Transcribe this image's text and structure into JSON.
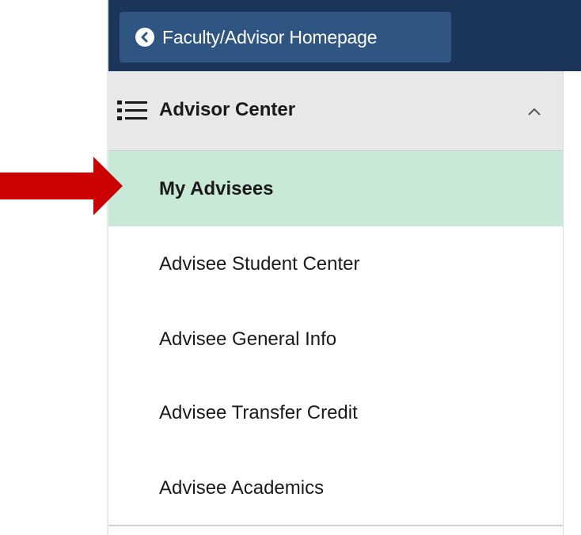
{
  "header": {
    "back_button_label": "Faculty/Advisor Homepage",
    "background_color": "#1c3659",
    "button_color": "#2f5582"
  },
  "nav": {
    "section_title": "Advisor Center",
    "section_icon": "list-icon",
    "collapse_icon": "chevron-up-icon",
    "items": [
      {
        "label": "My Advisees",
        "active": true
      },
      {
        "label": "Advisee Student Center",
        "active": false
      },
      {
        "label": "Advisee General Info",
        "active": false
      },
      {
        "label": "Advisee Transfer Credit",
        "active": false
      },
      {
        "label": "Advisee Academics",
        "active": false
      }
    ],
    "active_color": "#c9e9d8"
  },
  "annotation": {
    "arrow_icon": "red-arrow-icon",
    "arrow_color": "#cc0000"
  }
}
